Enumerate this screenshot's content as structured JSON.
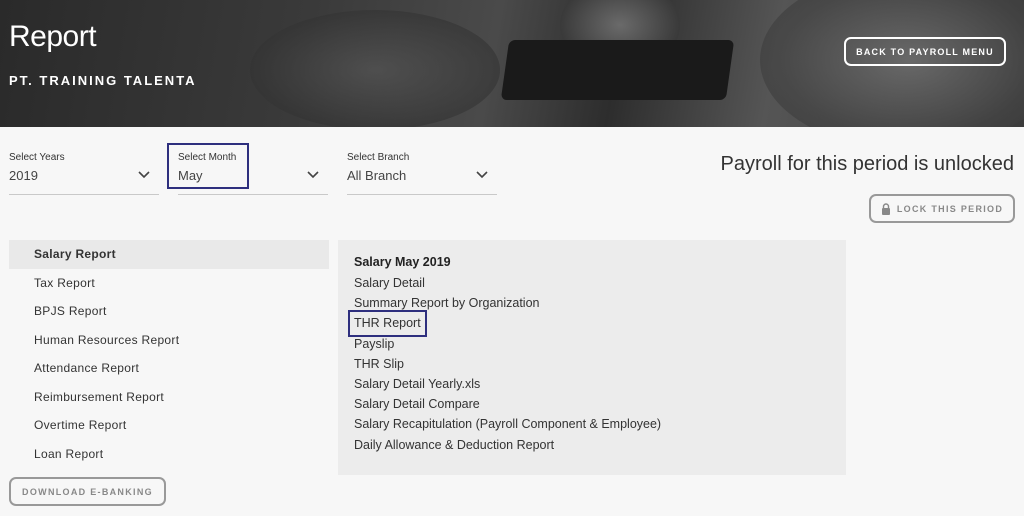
{
  "header": {
    "title": "Report",
    "company": "PT. TRAINING TALENTA",
    "back_label": "BACK TO PAYROLL MENU"
  },
  "filters": [
    {
      "label": "Select Years",
      "value": "2019"
    },
    {
      "label": "Select Month",
      "value": "May"
    },
    {
      "label": "Select Branch",
      "value": "All Branch"
    }
  ],
  "lock": {
    "status": "Payroll for this period is unlocked",
    "button_label": "LOCK THIS PERIOD"
  },
  "sidebar": {
    "items": [
      {
        "label": "Salary Report",
        "active": true
      },
      {
        "label": "Tax Report"
      },
      {
        "label": "BPJS Report"
      },
      {
        "label": "Human Resources Report"
      },
      {
        "label": "Attendance Report"
      },
      {
        "label": "Reimbursement Report"
      },
      {
        "label": "Overtime Report"
      },
      {
        "label": "Loan Report"
      }
    ],
    "download_label": "DOWNLOAD E-BANKING"
  },
  "panel": {
    "title": "Salary May 2019",
    "links": [
      "Salary Detail",
      "Summary Report by Organization",
      "THR Report",
      "Payslip",
      "THR Slip",
      "Salary Detail Yearly.xls",
      "Salary Detail Compare",
      "Salary Recapitulation (Payroll Component & Employee)",
      "Daily Allowance & Deduction Report"
    ]
  },
  "colors": {
    "highlight": "#2e2f7e",
    "active_bg": "#e9e9e9",
    "panel_bg": "#ececec"
  }
}
